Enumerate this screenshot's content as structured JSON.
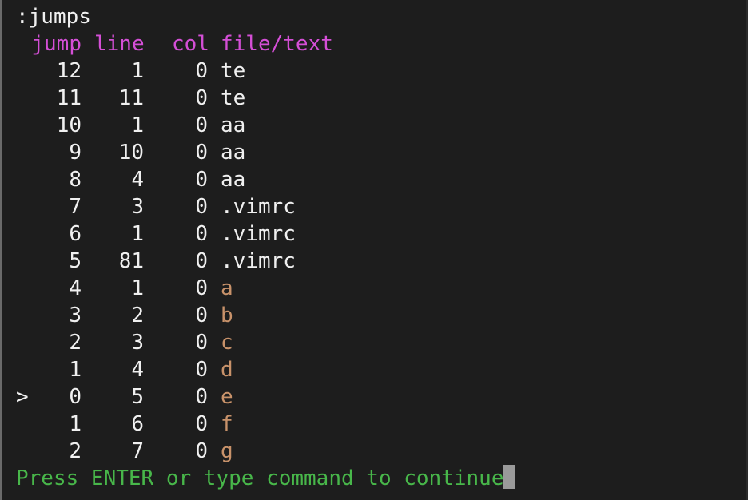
{
  "command": ":jumps",
  "headers": {
    "jump": "jump",
    "line": "line",
    "col": "col",
    "text": "file/text"
  },
  "rows": [
    {
      "marker": "",
      "jump": "12",
      "line": "1",
      "col": "0",
      "text": "te",
      "style": "plain"
    },
    {
      "marker": "",
      "jump": "11",
      "line": "11",
      "col": "0",
      "text": "te",
      "style": "plain"
    },
    {
      "marker": "",
      "jump": "10",
      "line": "1",
      "col": "0",
      "text": "aa",
      "style": "plain"
    },
    {
      "marker": "",
      "jump": "9",
      "line": "10",
      "col": "0",
      "text": "aa",
      "style": "plain"
    },
    {
      "marker": "",
      "jump": "8",
      "line": "4",
      "col": "0",
      "text": "aa",
      "style": "plain"
    },
    {
      "marker": "",
      "jump": "7",
      "line": "3",
      "col": "0",
      "text": ".vimrc",
      "style": "plain"
    },
    {
      "marker": "",
      "jump": "6",
      "line": "1",
      "col": "0",
      "text": ".vimrc",
      "style": "plain"
    },
    {
      "marker": "",
      "jump": "5",
      "line": "81",
      "col": "0",
      "text": ".vimrc",
      "style": "plain"
    },
    {
      "marker": "",
      "jump": "4",
      "line": "1",
      "col": "0",
      "text": "a",
      "style": "orange"
    },
    {
      "marker": "",
      "jump": "3",
      "line": "2",
      "col": "0",
      "text": "b",
      "style": "orange"
    },
    {
      "marker": "",
      "jump": "2",
      "line": "3",
      "col": "0",
      "text": "c",
      "style": "orange"
    },
    {
      "marker": "",
      "jump": "1",
      "line": "4",
      "col": "0",
      "text": "d",
      "style": "orange"
    },
    {
      "marker": ">",
      "jump": "0",
      "line": "5",
      "col": "0",
      "text": "e",
      "style": "orange"
    },
    {
      "marker": "",
      "jump": "1",
      "line": "6",
      "col": "0",
      "text": "f",
      "style": "orange"
    },
    {
      "marker": "",
      "jump": "2",
      "line": "7",
      "col": "0",
      "text": "g",
      "style": "orange"
    }
  ],
  "prompt": "Press ENTER or type command to continue",
  "colors": {
    "background": "#1d1d1d",
    "foreground": "#f0f0f0",
    "header": "#d44fd6",
    "buffer_text": "#c8926a",
    "prompt": "#48b74a",
    "cursor": "#9a9a9a"
  }
}
